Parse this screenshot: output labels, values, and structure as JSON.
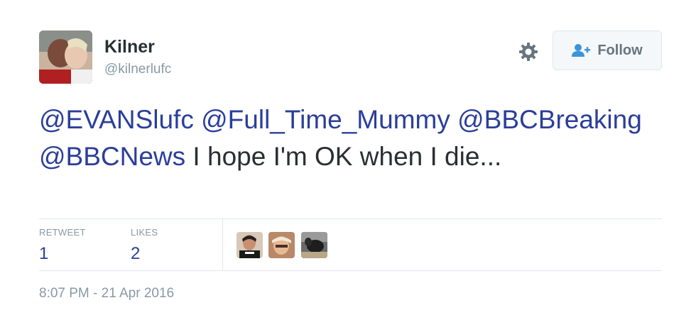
{
  "author": {
    "name": "Kilner",
    "handle": "@kilnerlufc",
    "follow_label": "Follow"
  },
  "tweet": {
    "mentions": [
      "@EVANSlufc",
      "@Full_Time_Mummy",
      "@BBCBreaking",
      "@BBCNews"
    ],
    "text": " I hope I'm OK when I die..."
  },
  "stats": {
    "retweet_label": "RETWEET",
    "retweet_count": "1",
    "likes_label": "LIKES",
    "likes_count": "2"
  },
  "timestamp": "8:07 PM - 21 Apr 2016",
  "icons": {
    "settings": "gear-icon",
    "follow": "follow-person-icon"
  },
  "colors": {
    "link": "#2b3e9a",
    "muted": "#8899a6",
    "text": "#292f33",
    "button_bg": "#f5f8fa",
    "button_icon": "#3b94d9"
  }
}
